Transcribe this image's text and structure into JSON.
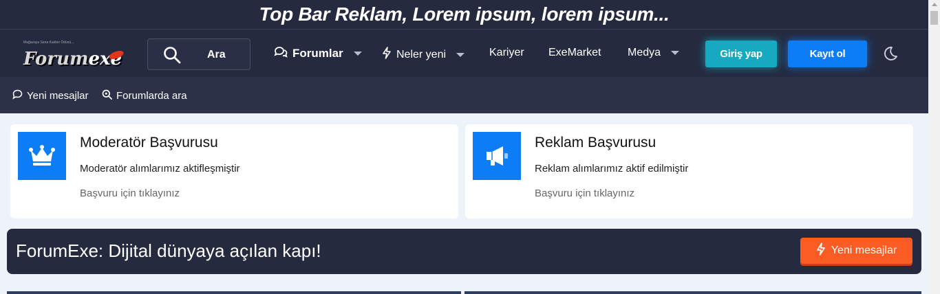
{
  "topbar": {
    "text": "Top Bar Reklam, Lorem ipsum, lorem ipsum..."
  },
  "logo": {
    "tagline": "Mağazaya Sana Kalıbın Ödüsü...",
    "text": "Forum",
    "text2": "exe"
  },
  "search": {
    "label": "Ara",
    "icon": "search-icon"
  },
  "nav": {
    "forums": "Forumlar",
    "whats_new": "Neler yeni",
    "career": "Kariyer",
    "market": "ExeMarket",
    "media": "Medya"
  },
  "auth": {
    "login": "Giriş yap",
    "register": "Kayıt ol"
  },
  "subnav": {
    "new_messages": "Yeni mesajlar",
    "search_forums": "Forumlarda ara"
  },
  "cards": [
    {
      "title": "Moderatör Başvurusu",
      "desc": "Moderatör alımlarımız aktifleşmiştir",
      "link": "Başvuru için tıklayınız",
      "icon": "crown-icon"
    },
    {
      "title": "Reklam Başvurusu",
      "desc": "Reklam alımlarımız aktif edilmiştir",
      "link": "Başvuru için tıklayınız",
      "icon": "megaphone-icon"
    }
  ],
  "banner": {
    "text": "ForumExe: Dijital dünyaya açılan kapı!",
    "button": "Yeni mesajlar"
  },
  "colors": {
    "dark": "#252a3f",
    "accent_blue": "#0d7df5",
    "accent_cyan": "#17a9c0",
    "accent_orange": "#fb5c24",
    "bg": "#eef2f9"
  }
}
